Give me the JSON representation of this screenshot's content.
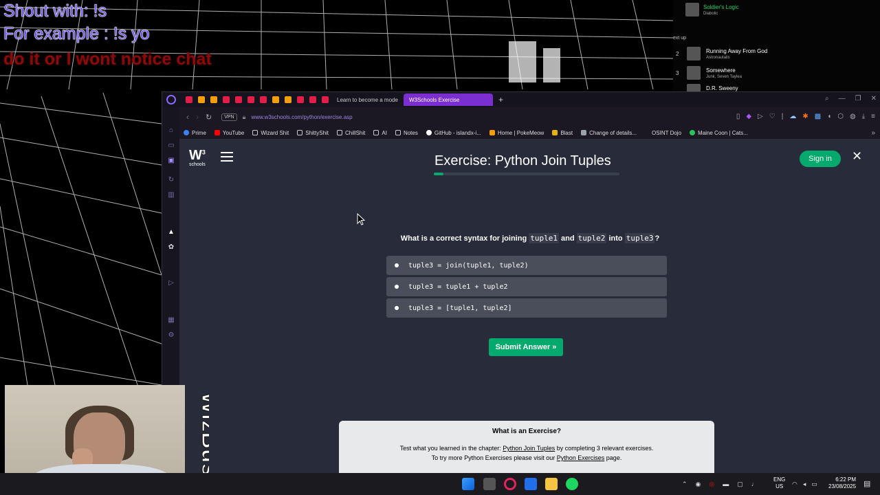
{
  "overlay": {
    "line1": "Shout with: !s",
    "line2": "For example : !s yo",
    "line3": "do it or I wont notice chat"
  },
  "queue": {
    "now_title": "Soldier's Logic",
    "now_artist": "Diabolic",
    "next_label": "ext up",
    "items": [
      {
        "num": "2",
        "title": "Running Away From God",
        "artist": "Astronautalis"
      },
      {
        "num": "3",
        "title": "Somewhere",
        "artist": "Junk, Seven Taylea"
      },
      {
        "num": "",
        "title": "D.R. Sweeny",
        "artist": ""
      }
    ]
  },
  "browser": {
    "tabs": [
      {
        "label": "Learn to become a mode",
        "active": false
      },
      {
        "label": "W3Schools Exercise",
        "active": true
      }
    ],
    "vpn": "VPN",
    "url": "www.w3schools.com/python/exercise.asp",
    "bookmarks": [
      {
        "label": "Prime",
        "color": "#3b82f6"
      },
      {
        "label": "YouTube",
        "color": "#ff0000"
      },
      {
        "label": "Wizard Shit",
        "color": "#cccccc"
      },
      {
        "label": "ShittyShit",
        "color": "#cccccc"
      },
      {
        "label": "ChillShit",
        "color": "#cccccc"
      },
      {
        "label": "AI",
        "color": "#cccccc"
      },
      {
        "label": "Notes",
        "color": "#cccccc"
      },
      {
        "label": "GitHub - islandx-i...",
        "color": "#ffffff"
      },
      {
        "label": "Home | PokeMeow",
        "color": "#f59e0b"
      },
      {
        "label": "Blast",
        "color": "#eab308"
      },
      {
        "label": "Change of details...",
        "color": "#9ca3af"
      },
      {
        "label": "OSINT Dojo",
        "color": "#1b1824"
      },
      {
        "label": "Maine Coon | Cats...",
        "color": "#22c55e"
      }
    ]
  },
  "page": {
    "logo_main": "W",
    "logo_sup": "3",
    "logo_sub": "schools",
    "title": "Exercise: Python Join Tuples",
    "progress": 0.05,
    "signin": "Sign in",
    "close": "✕",
    "question": {
      "prefix": "What is a correct syntax for joining",
      "code1": "tuple1",
      "and": "and",
      "code2": "tuple2",
      "into": "into",
      "code3": "tuple3",
      "suffix": "?"
    },
    "options": [
      "tuple3 = join(tuple1, tuple2)",
      "tuple3 = tuple1 + tuple2",
      "tuple3 = [tuple1, tuple2]"
    ],
    "submit": "Submit Answer »",
    "whatis": {
      "title": "What is an Exercise?",
      "line1_a": "Test what you learned in the chapter:",
      "line1_link": "Python Join Tuples",
      "line1_b": "by completing 3 relevant exercises.",
      "line2_a": "To try more Python Exercises please visit our",
      "line2_link": "Python Exercises",
      "line2_b": "page."
    }
  },
  "webcam_logo": "WizBusy",
  "taskbar": {
    "lang1": "ENG",
    "lang2": "US",
    "time": "6:22 PM",
    "date": "23/08/2025"
  },
  "colors": {
    "accent": "#04aa6d",
    "tab_active": "#7b2fd0",
    "page_bg": "#282c3a"
  }
}
